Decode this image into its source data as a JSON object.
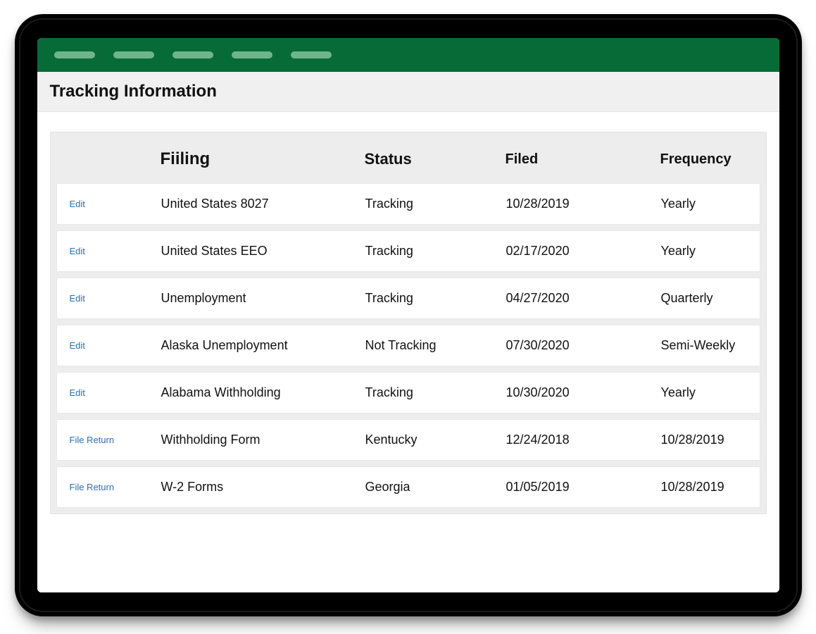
{
  "page": {
    "title": "Tracking Information"
  },
  "table": {
    "headers": {
      "filing": "Fiiling",
      "status": "Status",
      "filed": "Filed",
      "frequency": "Frequency"
    },
    "rows": [
      {
        "action": "Edit",
        "filing": "United States 8027",
        "status": "Tracking",
        "filed": "10/28/2019",
        "frequency": "Yearly"
      },
      {
        "action": "Edit",
        "filing": "United States EEO",
        "status": "Tracking",
        "filed": "02/17/2020",
        "frequency": "Yearly"
      },
      {
        "action": "Edit",
        "filing": "Unemployment",
        "status": "Tracking",
        "filed": "04/27/2020",
        "frequency": "Quarterly"
      },
      {
        "action": "Edit",
        "filing": "Alaska Unemployment",
        "status": "Not Tracking",
        "filed": "07/30/2020",
        "frequency": "Semi-Weekly"
      },
      {
        "action": "Edit",
        "filing": "Alabama Withholding",
        "status": "Tracking",
        "filed": "10/30/2020",
        "frequency": "Yearly"
      },
      {
        "action": "File Return",
        "filing": "Withholding Form",
        "status": "Kentucky",
        "filed": "12/24/2018",
        "frequency": "10/28/2019"
      },
      {
        "action": "File Return",
        "filing": "W-2 Forms",
        "status": "Georgia",
        "filed": "01/05/2019",
        "frequency": "10/28/2019"
      }
    ]
  },
  "colors": {
    "header_bg": "#076b38",
    "nav_pill": "#6fb58b",
    "link": "#2a6fb3"
  }
}
